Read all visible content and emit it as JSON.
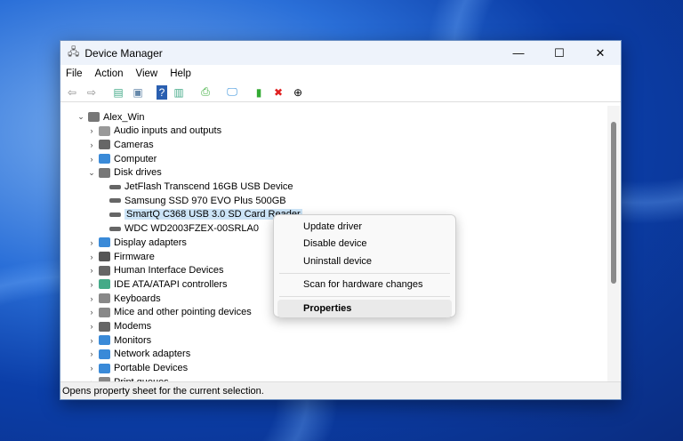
{
  "window": {
    "title": "Device Manager",
    "minimize": "—",
    "maximize": "☐",
    "close": "✕"
  },
  "menu": [
    "File",
    "Action",
    "View",
    "Help"
  ],
  "toolbar": [
    {
      "name": "back-icon",
      "g": "⇦",
      "c": "#888"
    },
    {
      "name": "forward-icon",
      "g": "⇨",
      "c": "#888"
    },
    {
      "name": "show-hide-console-tree-icon",
      "g": "▤",
      "c": "#4a8"
    },
    {
      "name": "properties-icon",
      "g": "▣",
      "c": "#68a"
    },
    {
      "name": "help-icon",
      "g": "?",
      "c": "#fff",
      "bg": "#2a5fb0"
    },
    {
      "name": "action-pane-icon",
      "g": "▥",
      "c": "#4a8"
    },
    {
      "name": "update-driver-icon",
      "g": "⎙",
      "c": "#3a3"
    },
    {
      "name": "scan-hardware-icon",
      "g": "🖵",
      "c": "#2a8ad8"
    },
    {
      "name": "enable-device-icon",
      "g": "▮",
      "c": "#3a3"
    },
    {
      "name": "uninstall-icon",
      "g": "✖",
      "c": "#e02020"
    },
    {
      "name": "disable-device-icon",
      "g": "⊕",
      "c": "#000"
    }
  ],
  "tree": [
    {
      "label": "Alex_Win",
      "level": 0,
      "arrow": "⌄",
      "color": "#777"
    },
    {
      "label": "Audio inputs and outputs",
      "level": 1,
      "arrow": "›",
      "color": "#999"
    },
    {
      "label": "Cameras",
      "level": 1,
      "arrow": "›",
      "color": "#666"
    },
    {
      "label": "Computer",
      "level": 1,
      "arrow": "›",
      "color": "#3a8ad8"
    },
    {
      "label": "Disk drives",
      "level": 1,
      "arrow": "⌄",
      "color": "#777"
    },
    {
      "label": "JetFlash Transcend 16GB USB Device",
      "level": 2,
      "color": "#666"
    },
    {
      "label": "Samsung SSD 970 EVO Plus 500GB",
      "level": 2,
      "color": "#666"
    },
    {
      "label": "SmartQ C368 USB 3.0 SD Card Reader",
      "level": 2,
      "color": "#666",
      "selected": true
    },
    {
      "label": "WDC WD2003FZEX-00SRLA0",
      "level": 2,
      "color": "#666"
    },
    {
      "label": "Display adapters",
      "level": 1,
      "arrow": "›",
      "color": "#3a8ad8"
    },
    {
      "label": "Firmware",
      "level": 1,
      "arrow": "›",
      "color": "#555"
    },
    {
      "label": "Human Interface Devices",
      "level": 1,
      "arrow": "›",
      "color": "#666"
    },
    {
      "label": "IDE ATA/ATAPI controllers",
      "level": 1,
      "arrow": "›",
      "color": "#4a8"
    },
    {
      "label": "Keyboards",
      "level": 1,
      "arrow": "›",
      "color": "#888"
    },
    {
      "label": "Mice and other pointing devices",
      "level": 1,
      "arrow": "›",
      "color": "#888"
    },
    {
      "label": "Modems",
      "level": 1,
      "arrow": "›",
      "color": "#666"
    },
    {
      "label": "Monitors",
      "level": 1,
      "arrow": "›",
      "color": "#3a8ad8"
    },
    {
      "label": "Network adapters",
      "level": 1,
      "arrow": "›",
      "color": "#3a8ad8"
    },
    {
      "label": "Portable Devices",
      "level": 1,
      "arrow": "›",
      "color": "#3a8ad8"
    },
    {
      "label": "Print queues",
      "level": 1,
      "arrow": "›",
      "color": "#888"
    }
  ],
  "context_menu": {
    "items": [
      "Update driver",
      "Disable device",
      "Uninstall device",
      "Scan for hardware changes",
      "Properties"
    ]
  },
  "status": "Opens property sheet for the current selection."
}
